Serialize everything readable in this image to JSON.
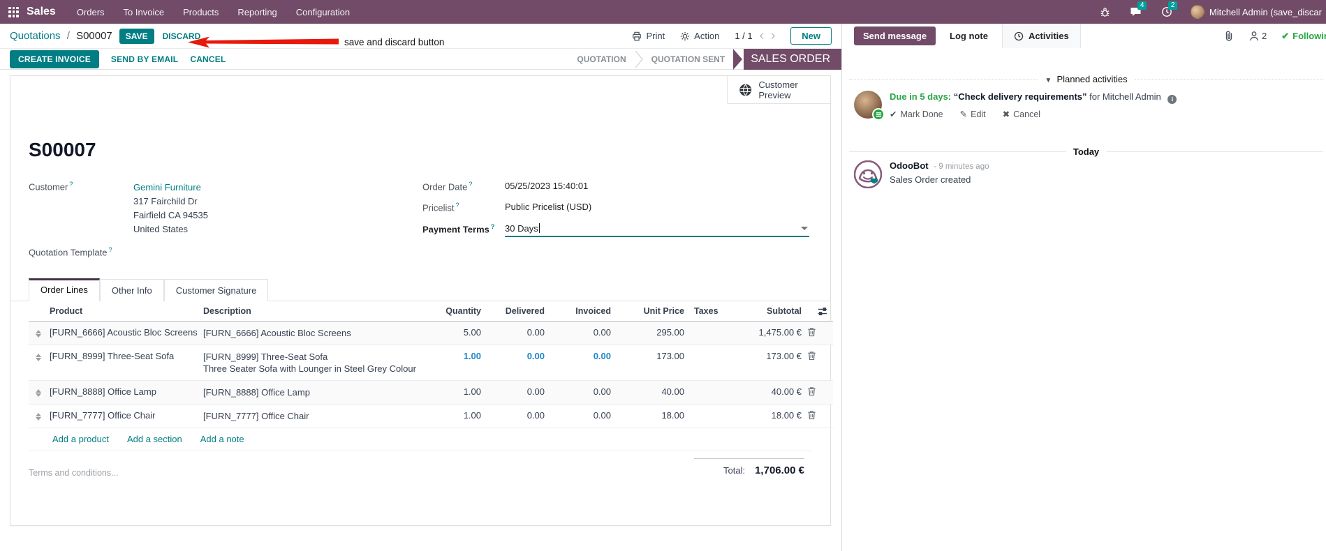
{
  "nav": {
    "app": "Sales",
    "menus": [
      "Orders",
      "To Invoice",
      "Products",
      "Reporting",
      "Configuration"
    ],
    "messages_badge": "4",
    "activities_badge": "2",
    "user": "Mitchell Admin (save_discar"
  },
  "control": {
    "breadcrumb_parent": "Quotations",
    "breadcrumb_sep": "/",
    "breadcrumb_current": "S00007",
    "save": "SAVE",
    "discard": "DISCARD",
    "print": "Print",
    "action": "Action",
    "pager": "1 / 1",
    "prev": "‹",
    "next": "›",
    "new": "New"
  },
  "annotation": {
    "text": "save and discard button",
    "color": "#e8190c"
  },
  "status": {
    "buttons": [
      "CREATE INVOICE",
      "SEND BY EMAIL",
      "CANCEL"
    ],
    "steps": [
      "QUOTATION",
      "QUOTATION SENT",
      "SALES ORDER"
    ],
    "active_step": "SALES ORDER"
  },
  "sheet": {
    "preview_label": "Customer Preview",
    "name": "S00007",
    "customer_label": "Customer",
    "customer_name": "Gemini Furniture",
    "customer_address": [
      "317 Fairchild Dr",
      "Fairfield CA 94535",
      "United States"
    ],
    "quotation_template_label": "Quotation Template",
    "order_date_label": "Order Date",
    "order_date": "05/25/2023 15:40:01",
    "pricelist_label": "Pricelist",
    "pricelist": "Public Pricelist (USD)",
    "payment_terms_label": "Payment Terms",
    "payment_terms": "30 Days"
  },
  "tabs": [
    "Order Lines",
    "Other Info",
    "Customer Signature"
  ],
  "order_lines": {
    "headers": {
      "product": "Product",
      "description": "Description",
      "quantity": "Quantity",
      "delivered": "Delivered",
      "invoiced": "Invoiced",
      "unit_price": "Unit Price",
      "taxes": "Taxes",
      "subtotal": "Subtotal"
    },
    "rows": [
      {
        "product": "[FURN_6666] Acoustic Bloc Screens",
        "description": [
          "[FURN_6666] Acoustic Bloc Screens"
        ],
        "quantity": "5.00",
        "delivered": "0.00",
        "invoiced": "0.00",
        "unit_price": "295.00",
        "taxes": "",
        "subtotal": "1,475.00 €",
        "edited": false
      },
      {
        "product": "[FURN_8999] Three-Seat Sofa",
        "description": [
          "[FURN_8999] Three-Seat Sofa",
          "Three Seater Sofa with Lounger in Steel Grey Colour"
        ],
        "quantity": "1.00",
        "delivered": "0.00",
        "invoiced": "0.00",
        "unit_price": "173.00",
        "taxes": "",
        "subtotal": "173.00 €",
        "edited": true
      },
      {
        "product": "[FURN_8888] Office Lamp",
        "description": [
          "[FURN_8888] Office Lamp"
        ],
        "quantity": "1.00",
        "delivered": "0.00",
        "invoiced": "0.00",
        "unit_price": "40.00",
        "taxes": "",
        "subtotal": "40.00 €",
        "edited": false
      },
      {
        "product": "[FURN_7777] Office Chair",
        "description": [
          "[FURN_7777] Office Chair"
        ],
        "quantity": "1.00",
        "delivered": "0.00",
        "invoiced": "0.00",
        "unit_price": "18.00",
        "taxes": "",
        "subtotal": "18.00 €",
        "edited": false
      }
    ],
    "add_links": [
      "Add a product",
      "Add a section",
      "Add a note"
    ]
  },
  "footer": {
    "terms_placeholder": "Terms and conditions...",
    "total_label": "Total:",
    "total_value": "1,706.00 €"
  },
  "chatter": {
    "send_message": "Send message",
    "log_note": "Log note",
    "activities": "Activities",
    "followers_count": "2",
    "following": "Following",
    "planned_header": "Planned activities",
    "activity": {
      "due": "Due in 5 days:",
      "summary": "“Check delivery requirements”",
      "for_text": "for Mitchell Admin",
      "mark_done": "Mark Done",
      "edit": "Edit",
      "cancel": "Cancel"
    },
    "today": "Today",
    "message": {
      "author": "OdooBot",
      "time": "- 9 minutes ago",
      "body": "Sales Order created"
    }
  },
  "colors": {
    "navbar_purple": "#714B67",
    "primary_teal": "#017e84",
    "edited_blue": "#2187c7",
    "success_green": "#28a745",
    "annotation_red": "#e8190c",
    "badge_teal": "#00A09D"
  }
}
